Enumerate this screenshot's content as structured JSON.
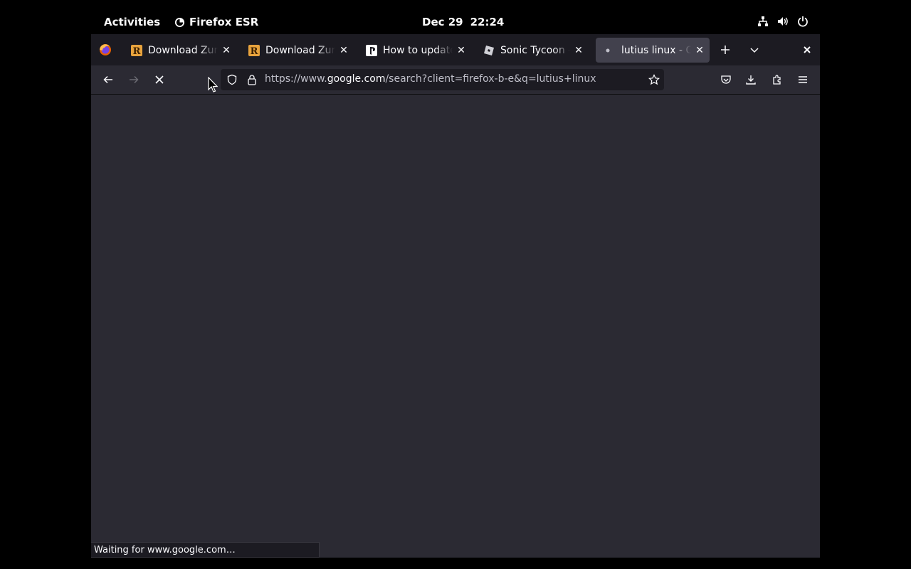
{
  "topbar": {
    "activities": "Activities",
    "app_name": "Firefox ESR",
    "date": "Dec 29",
    "time": "22:24",
    "tray_icons": [
      "network-icon",
      "volume-icon",
      "power-icon"
    ]
  },
  "browser": {
    "tabs": [
      {
        "title": "Download Zuma",
        "favicon": "rutracker-icon",
        "selected": false
      },
      {
        "title": "Download Zuma",
        "favicon": "rutracker-icon",
        "selected": false
      },
      {
        "title": "How to update P",
        "favicon": "playstation-icon",
        "selected": false
      },
      {
        "title": "Sonic Tycoon - R",
        "favicon": "roblox-icon",
        "selected": false
      },
      {
        "title": "lutius linux - Goo",
        "favicon": "loading-dot-icon",
        "selected": true
      }
    ],
    "url_prefix": "https://www.",
    "url_domain": "google.com",
    "url_rest": "/search?client=firefox-b-e&q=lutius+linux",
    "status_text": "Waiting for www.google.com…"
  },
  "colors": {
    "chrome_dark": "#1c1b22",
    "chrome": "#2b2a33",
    "selected_tab": "#42414d",
    "accent": "#fbfbfe"
  }
}
